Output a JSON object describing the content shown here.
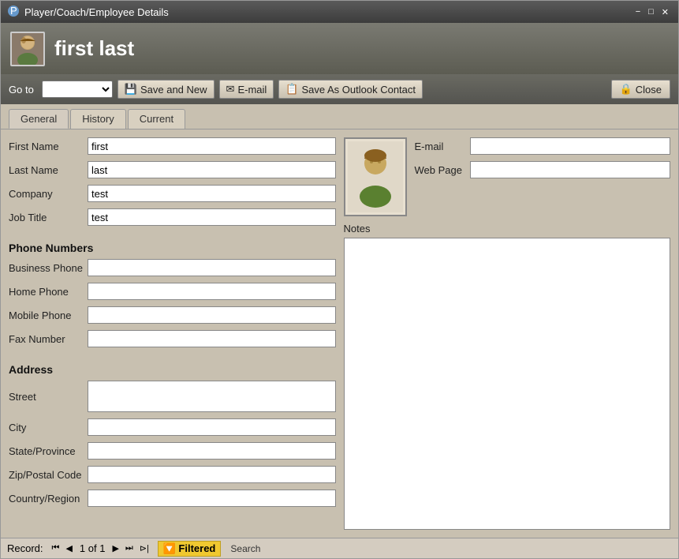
{
  "window": {
    "title": "Player/Coach/Employee Details",
    "controls": {
      "minimize": "−",
      "maximize": "□",
      "close": "✕"
    }
  },
  "header": {
    "name": "first last"
  },
  "toolbar": {
    "goto_label": "Go to",
    "goto_placeholder": "",
    "save_new_label": "Save and New",
    "email_label": "E-mail",
    "save_outlook_label": "Save As Outlook Contact",
    "close_label": "Close"
  },
  "tabs": [
    {
      "id": "general",
      "label": "General",
      "active": true
    },
    {
      "id": "history",
      "label": "History",
      "active": false
    },
    {
      "id": "current",
      "label": "Current",
      "active": false
    }
  ],
  "form": {
    "fields": {
      "first_name_label": "First Name",
      "first_name_value": "first",
      "last_name_label": "Last Name",
      "last_name_value": "last",
      "company_label": "Company",
      "company_value": "test",
      "job_title_label": "Job Title",
      "job_title_value": "test",
      "email_label": "E-mail",
      "email_value": "",
      "web_page_label": "Web Page",
      "web_page_value": ""
    },
    "phone_numbers": {
      "section_title": "Phone Numbers",
      "business_phone_label": "Business Phone",
      "business_phone_value": "",
      "home_phone_label": "Home Phone",
      "home_phone_value": "",
      "mobile_phone_label": "Mobile Phone",
      "mobile_phone_value": "",
      "fax_number_label": "Fax Number",
      "fax_number_value": ""
    },
    "address": {
      "section_title": "Address",
      "street_label": "Street",
      "street_value": "",
      "city_label": "City",
      "city_value": "",
      "state_label": "State/Province",
      "state_value": "",
      "zip_label": "Zip/Postal Code",
      "zip_value": "",
      "country_label": "Country/Region",
      "country_value": ""
    },
    "notes_label": "Notes"
  },
  "statusbar": {
    "record_prefix": "Record:",
    "first_btn": "⏮",
    "prev_btn": "◀",
    "record_count": "1 of 1",
    "next_btn": "▶",
    "last_btn": "⏭",
    "new_btn": "⊳|",
    "filtered_label": "Filtered",
    "search_label": "Search"
  }
}
